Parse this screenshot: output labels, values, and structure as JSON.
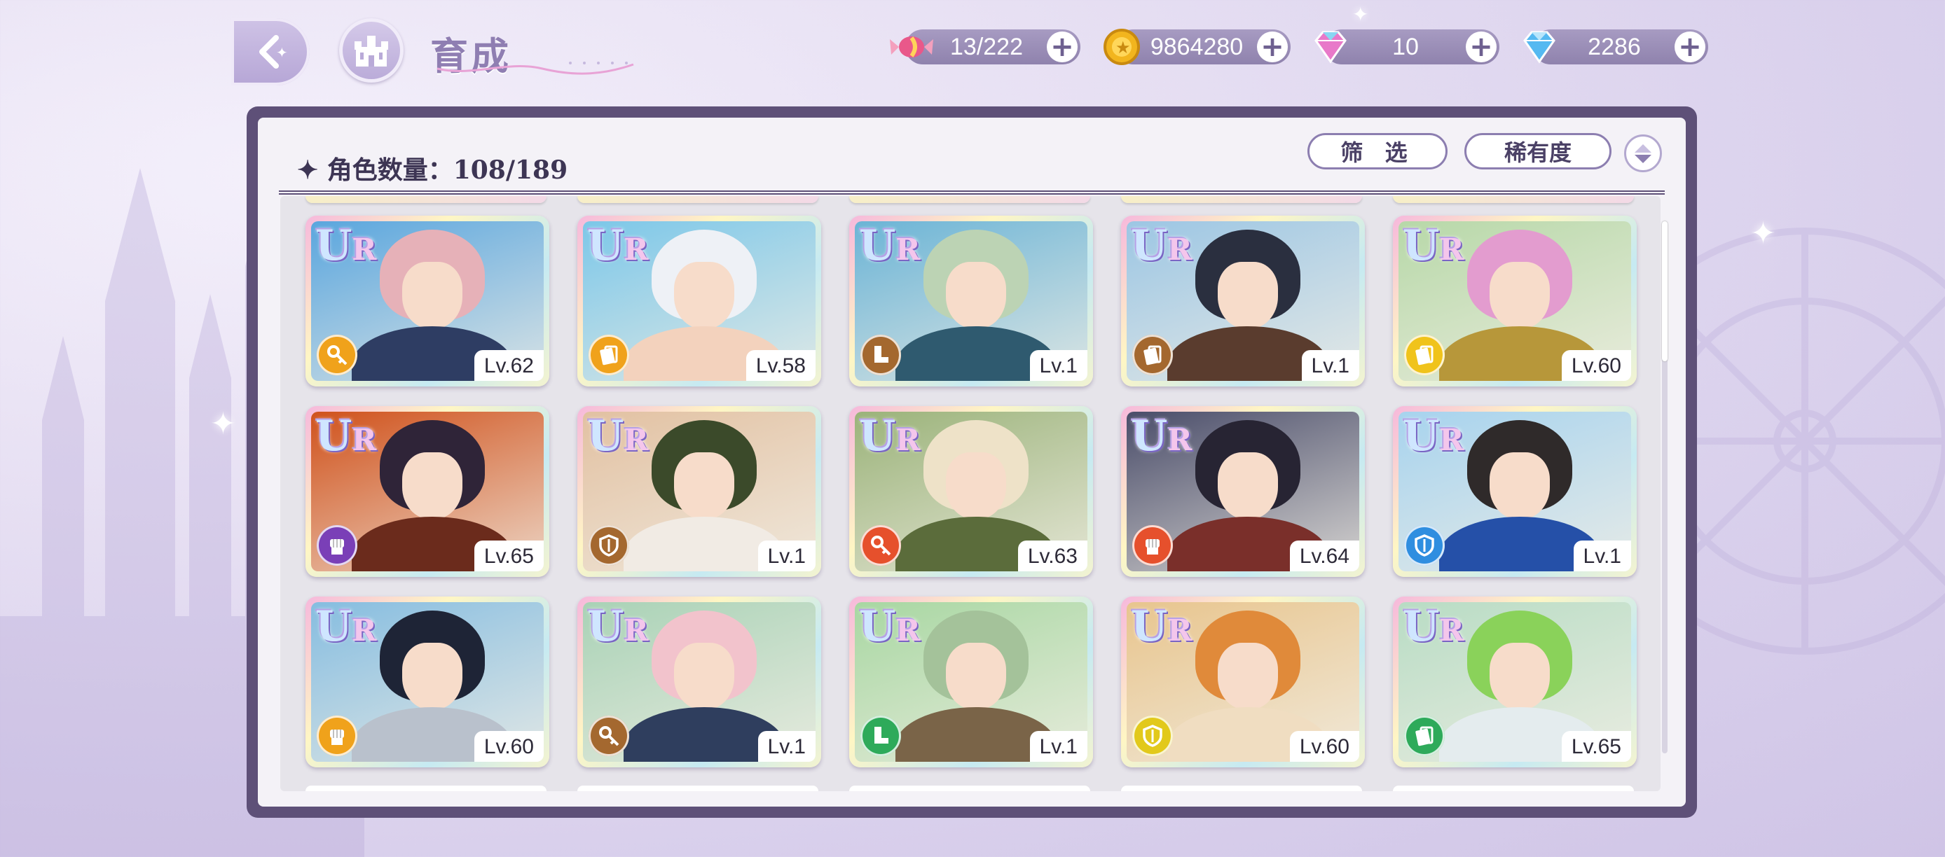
{
  "header": {
    "title": "育成",
    "currencies": [
      {
        "name": "candy",
        "value": "13/222",
        "color": "#e9588a"
      },
      {
        "name": "gold-coin",
        "value": "9864280",
        "color": "#f2b51e"
      },
      {
        "name": "pink-gem",
        "value": "10",
        "color": "#e879c9"
      },
      {
        "name": "blue-gem",
        "value": "2286",
        "color": "#55b9f1"
      }
    ]
  },
  "panel": {
    "count_label": "✦ 角色数量：108/189",
    "filter_label": "筛 选",
    "rarity_label": "稀有度"
  },
  "cards": [
    {
      "rarity_u": "U",
      "rarity_r": "R",
      "level": "Lv.62",
      "type_color": "#f0a21b",
      "type_icon": "key-icon",
      "sky": "#5aa6de",
      "hair": "#e6b1b8",
      "body": "#2e3d63"
    },
    {
      "rarity_u": "U",
      "rarity_r": "R",
      "level": "Lv.58",
      "type_color": "#f0a21b",
      "type_icon": "card-icon",
      "sky": "#7cc7e8",
      "hair": "#eef1f6",
      "body": "#f3d2bd"
    },
    {
      "rarity_u": "U",
      "rarity_r": "R",
      "level": "Lv.1",
      "type_color": "#a4682f",
      "type_icon": "boot-icon",
      "sky": "#6bb4d6",
      "hair": "#bcd3b4",
      "body": "#2f5a6f"
    },
    {
      "rarity_u": "U",
      "rarity_r": "R",
      "level": "Lv.1",
      "type_color": "#a4682f",
      "type_icon": "card-icon",
      "sky": "#9cc6e4",
      "hair": "#2a2f3f",
      "body": "#5a3c2e"
    },
    {
      "rarity_u": "U",
      "rarity_r": "R",
      "level": "Lv.60",
      "type_color": "#f0c31b",
      "type_icon": "card-icon",
      "sky": "#b7d8a8",
      "hair": "#e39ccf",
      "body": "#b7973a"
    },
    {
      "rarity_u": "U",
      "rarity_r": "R",
      "level": "Lv.65",
      "type_color": "#7a3fb7",
      "type_icon": "fist-icon",
      "sky": "#d0521c",
      "hair": "#2f2438",
      "body": "#6b2b1c"
    },
    {
      "rarity_u": "U",
      "rarity_r": "R",
      "level": "Lv.1",
      "type_color": "#a4682f",
      "type_icon": "shield-icon",
      "sky": "#e2c1a2",
      "hair": "#3b4a2a",
      "body": "#f1ebe4"
    },
    {
      "rarity_u": "U",
      "rarity_r": "R",
      "level": "Lv.63",
      "type_color": "#e6502c",
      "type_icon": "key-icon",
      "sky": "#9bb37a",
      "hair": "#eee2c8",
      "body": "#5b6c3b"
    },
    {
      "rarity_u": "U",
      "rarity_r": "R",
      "level": "Lv.64",
      "type_color": "#e6502c",
      "type_icon": "fist-icon",
      "sky": "#4a4d6a",
      "hair": "#272433",
      "body": "#7a2f2a"
    },
    {
      "rarity_u": "U",
      "rarity_r": "R",
      "level": "Lv.1",
      "type_color": "#2f8ee0",
      "type_icon": "shield-icon",
      "sky": "#a7d3ee",
      "hair": "#2f2a2a",
      "body": "#2550a8"
    },
    {
      "rarity_u": "U",
      "rarity_r": "R",
      "level": "Lv.60",
      "type_color": "#f0a21b",
      "type_icon": "fist-icon",
      "sky": "#86bde0",
      "hair": "#1e2436",
      "body": "#b9c1cc"
    },
    {
      "rarity_u": "U",
      "rarity_r": "R",
      "level": "Lv.1",
      "type_color": "#a4682f",
      "type_icon": "key-icon",
      "sky": "#a9d2b6",
      "hair": "#f2c3cc",
      "body": "#2f3e5e"
    },
    {
      "rarity_u": "U",
      "rarity_r": "R",
      "level": "Lv.1",
      "type_color": "#2eaa5a",
      "type_icon": "boot-icon",
      "sky": "#a8d7a2",
      "hair": "#a4c29a",
      "body": "#7a6448"
    },
    {
      "rarity_u": "U",
      "rarity_r": "R",
      "level": "Lv.60",
      "type_color": "#e2c91b",
      "type_icon": "shield-icon",
      "sky": "#e8c58e",
      "hair": "#e08a3a",
      "body": "#f0ddc1"
    },
    {
      "rarity_u": "U",
      "rarity_r": "R",
      "level": "Lv.65",
      "type_color": "#2eaa5a",
      "type_icon": "card-icon",
      "sky": "#b8dcc4",
      "hair": "#8ad25a",
      "body": "#e4ecee"
    }
  ]
}
